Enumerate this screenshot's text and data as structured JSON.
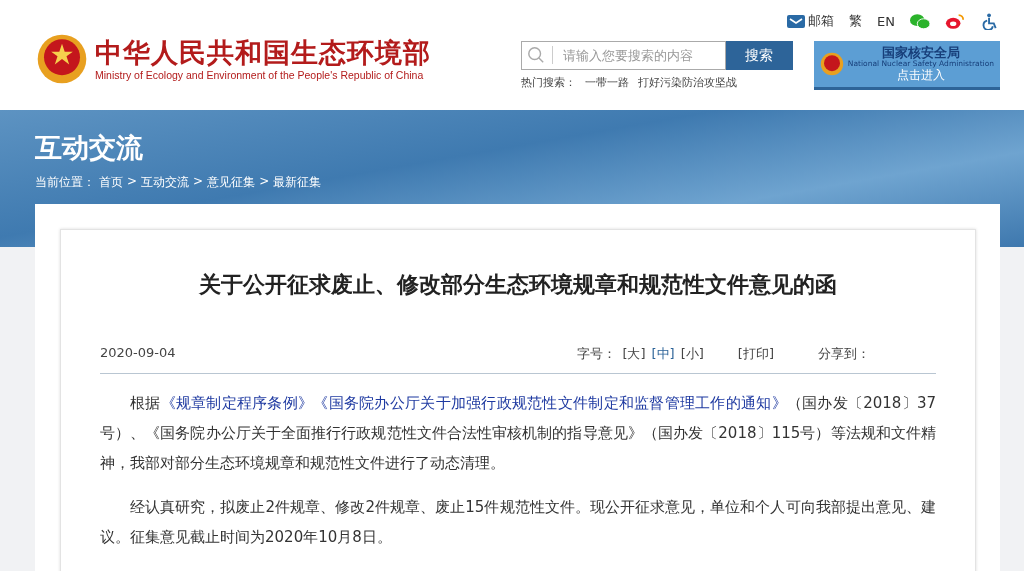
{
  "header": {
    "title": "中华人民共和国生态环境部",
    "subtitle": "Ministry of Ecology and Environment of the People's Republic of China",
    "top_links": [
      {
        "kind": "mail",
        "label": "邮箱"
      },
      {
        "kind": "text",
        "label": "繁"
      },
      {
        "kind": "text",
        "label": "EN"
      },
      {
        "kind": "wechat"
      },
      {
        "kind": "weibo"
      },
      {
        "kind": "accessibility"
      }
    ],
    "search": {
      "placeholder": "请输入您要搜索的内容",
      "button": "搜索"
    },
    "hot_search": {
      "label": "热门搜索：",
      "items": [
        "一带一路",
        "打好污染防治攻坚战"
      ]
    },
    "nsa_banner": {
      "title": "国家核安全局",
      "subtitle": "National Nuclear Safety Administration",
      "action": "点击进入"
    }
  },
  "banner": {
    "title": "互动交流",
    "breadcrumb_label": "当前位置：",
    "breadcrumb_separator": ">",
    "breadcrumb": [
      "首页",
      "互动交流",
      "意见征集",
      "最新征集"
    ]
  },
  "article": {
    "title": "关于公开征求废止、修改部分生态环境规章和规范性文件意见的函",
    "date": "2020-09-04",
    "font_size_label": "字号：",
    "font_sizes": [
      {
        "label": "[大]",
        "selected": false
      },
      {
        "label": "[中]",
        "selected": true
      },
      {
        "label": "[小]",
        "selected": false
      }
    ],
    "print": "[打印]",
    "share": "分享到：",
    "paragraphs": [
      [
        {
          "text": "根据"
        },
        {
          "text": "《规章制定程序条例》",
          "link": true
        },
        {
          "text": "《国务院办公厅关于加强行政规范性文件制定和监督管理工作的通知》",
          "link": true
        },
        {
          "text": "（国办发〔2018〕37号）、《国务院办公厅关于全面推行行政规范性文件合法性审核机制的指导意见》（国办发〔2018〕115号）等法规和文件精神，我部对部分生态环境规章和规范性文件进行了动态清理。"
        }
      ],
      [
        {
          "text": "经认真研究，拟废止2件规章、修改2件规章、废止15件规范性文件。现公开征求意见，单位和个人可向我部提出意见、建议。征集意见截止时间为2020年10月8日。"
        }
      ]
    ]
  }
}
